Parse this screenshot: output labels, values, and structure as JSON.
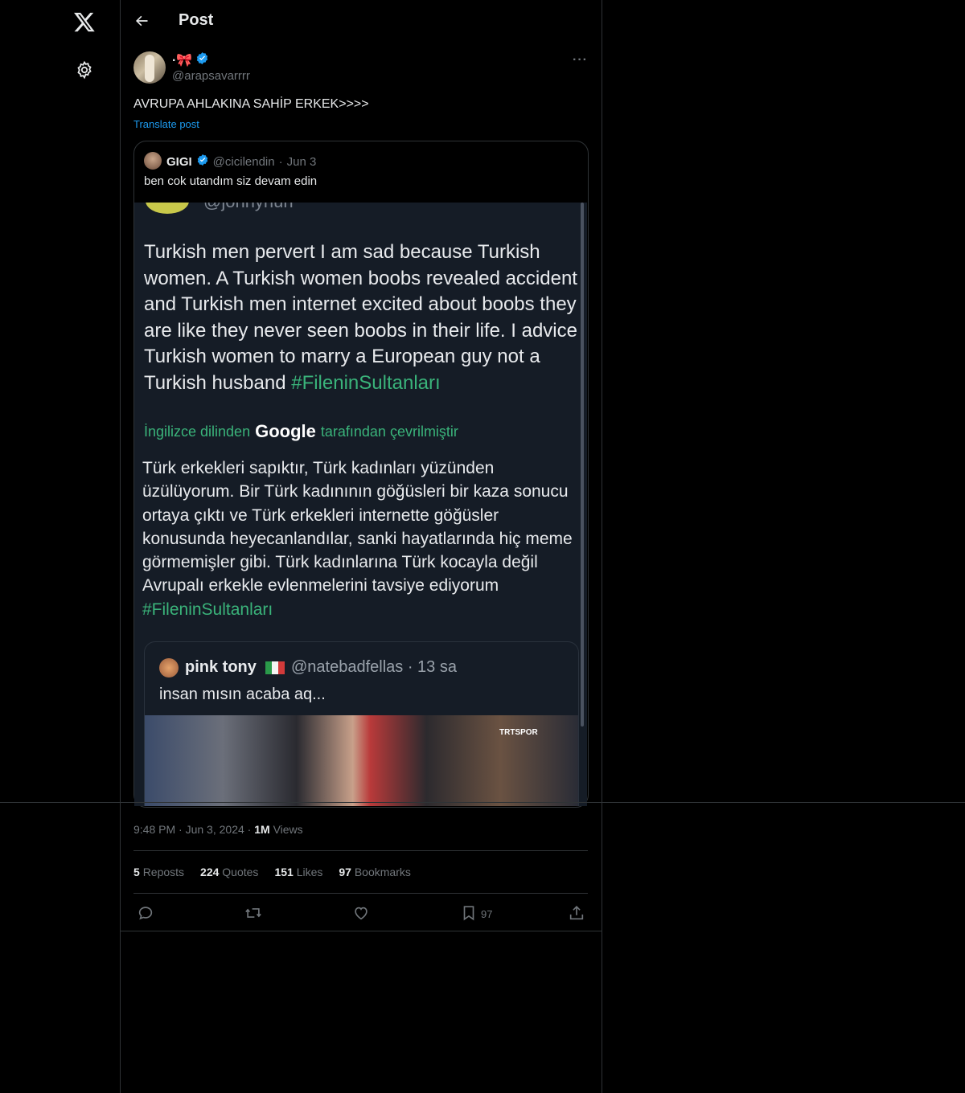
{
  "header": {
    "title": "Post"
  },
  "post": {
    "display_name": "·🎀",
    "handle": "@arapsavarrrr",
    "text": "AVRUPA AHLAKINA SAHİP ERKEK>>>>",
    "translate_label": "Translate post",
    "timestamp_time": "9:48 PM",
    "timestamp_date": "Jun 3, 2024",
    "views_count": "1M",
    "views_label": "Views"
  },
  "quote": {
    "display_name": "GIGI",
    "handle": "@cicilendin",
    "date": "Jun 3",
    "text": "ben cok utandım siz devam edin"
  },
  "media": {
    "cut_handle": "@johnyhurr",
    "english_text": "Turkish men pervert I am sad because Turkish women. A Turkish women boobs revealed accident and Turkish men internet excited about boobs they are  like they never seen boobs in their life. I advice Turkish women to marry a European guy not a Turkish husband",
    "english_hashtag": "#FileninSultanları",
    "translated_prefix": "İngilizce dilinden",
    "translated_google": "Google",
    "translated_suffix": "tarafından çevrilmiştir",
    "turkish_text": "Türk erkekleri sapıktır, Türk kadınları yüzünden üzülüyorum. Bir Türk kadınının göğüsleri bir kaza sonucu ortaya çıktı ve Türk erkekleri internette göğüsler konusunda heyecanlandılar, sanki hayatlarında hiç meme görmemişler gibi. Türk kadınlarına Türk kocayla değil Avrupalı erkekle evlenmelerini tavsiye ediyorum",
    "turkish_hashtag": "#FileninSultanları",
    "inner": {
      "name": "pink tony",
      "handle_time": "@natebadfellas · 13 sa",
      "text": "insan mısın acaba aq...",
      "logo": "TRTSPOR"
    }
  },
  "stats": {
    "reposts_count": "5",
    "reposts_label": "Reposts",
    "quotes_count": "224",
    "quotes_label": "Quotes",
    "likes_count": "151",
    "likes_label": "Likes",
    "bookmarks_count": "97",
    "bookmarks_label": "Bookmarks"
  },
  "actions": {
    "bookmark_count": "97"
  },
  "colors": {
    "accent": "#1d9bf0",
    "hashtag": "#3ab37a",
    "background": "#000000",
    "border": "#2f3336"
  }
}
